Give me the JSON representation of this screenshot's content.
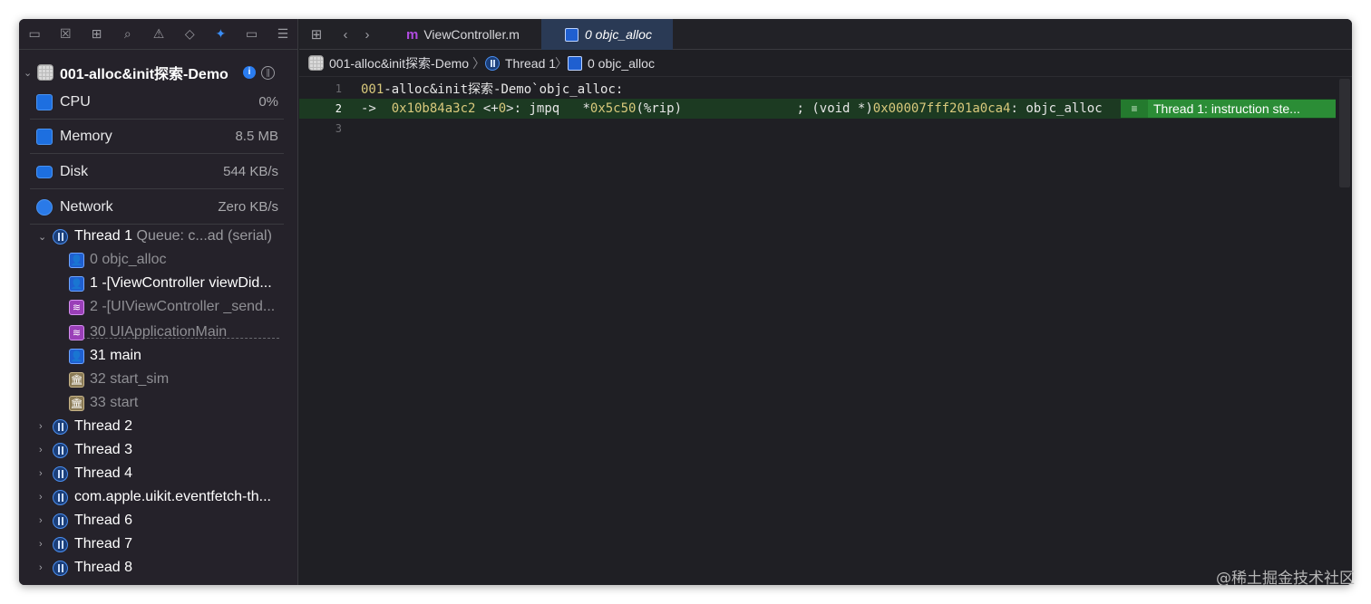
{
  "nav_toolbar": {
    "icons": [
      "folder-icon",
      "source-control-icon",
      "symbol-icon",
      "search-icon",
      "warning-icon",
      "test-icon",
      "debug-icon",
      "breakpoint-icon",
      "report-icon"
    ]
  },
  "process": {
    "name": "001-alloc&init探索-Demo"
  },
  "gauges": [
    {
      "label": "CPU",
      "value": "0%"
    },
    {
      "label": "Memory",
      "value": "8.5 MB"
    },
    {
      "label": "Disk",
      "value": "544 KB/s"
    },
    {
      "label": "Network",
      "value": "Zero KB/s"
    }
  ],
  "thread1": {
    "label": "Thread 1",
    "queue": "Queue: c...ad (serial)"
  },
  "frames": [
    {
      "label": "0 objc_alloc",
      "kind": "user",
      "style": "gray"
    },
    {
      "label": "1 -[ViewController viewDid...",
      "kind": "user",
      "style": "white"
    },
    {
      "label": "2 -[UIViewController _send...",
      "kind": "stack",
      "style": "gray"
    },
    {
      "label": "30 UIApplicationMain",
      "kind": "stack",
      "style": "gray"
    },
    {
      "label": "31 main",
      "kind": "user",
      "style": "white"
    },
    {
      "label": "32 start_sim",
      "kind": "sys",
      "style": "gray"
    },
    {
      "label": "33 start",
      "kind": "sys",
      "style": "gray"
    }
  ],
  "threads": [
    "Thread 2",
    "Thread 3",
    "Thread 4",
    "com.apple.uikit.eventfetch-th...",
    "Thread 6",
    "Thread 7",
    "Thread 8"
  ],
  "tabs": {
    "inactive": {
      "icon_letter": "m",
      "label": "ViewController.m"
    },
    "active": {
      "label": "0 objc_alloc"
    }
  },
  "jumpbar": {
    "project": "001-alloc&init探索-Demo",
    "thread": "Thread 1",
    "frame": "0 objc_alloc"
  },
  "code": {
    "line1": {
      "number": "1",
      "prefix": "001",
      "text": "-alloc&init探索-Demo`objc_alloc:"
    },
    "line2": {
      "number": "2",
      "arrow": "->",
      "address": "0x10b84a3c2",
      "offset_open": "<+",
      "offset": "0",
      "offset_close": ">: jmpq   *",
      "operand": "0x5c50",
      "reg": "(%rip)",
      "comment_pre": "               ; (void *)",
      "target": "0x00007fff201a0ca4",
      "comment_post": ": objc_alloc"
    },
    "line3": {
      "number": "3"
    },
    "badge": "Thread 1: instruction ste..."
  },
  "watermark": "@稀土掘金技术社区",
  "colors": {
    "accent": "#3a8df5",
    "highlight": "#2b8d36",
    "number": "#d9c97c"
  }
}
